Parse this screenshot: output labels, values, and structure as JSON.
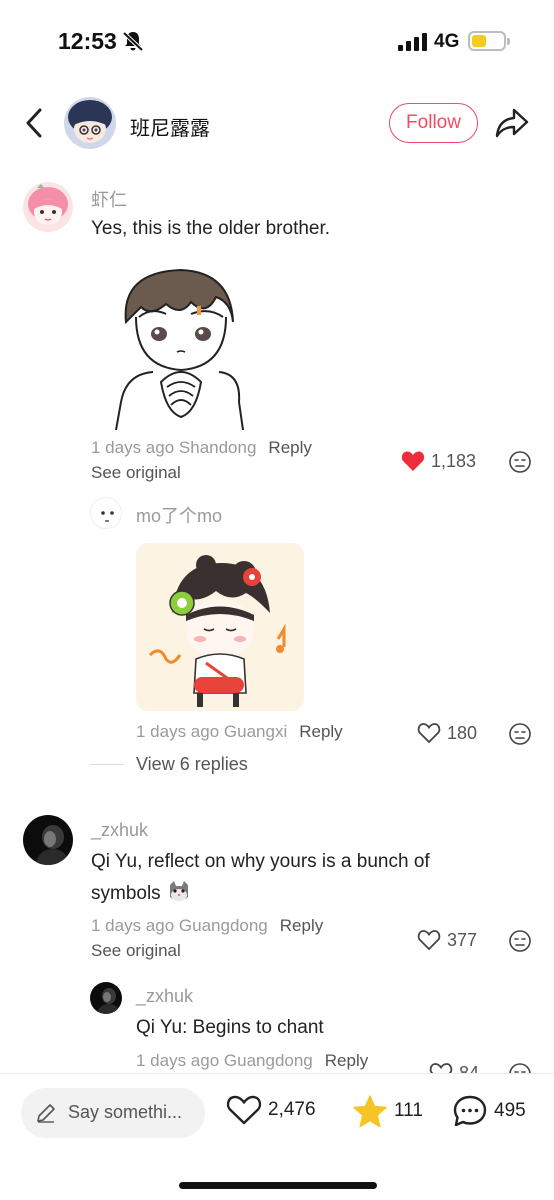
{
  "status_bar": {
    "time": "12:53",
    "network": "4G"
  },
  "header": {
    "author_name": "班尼露露",
    "follow_label": "Follow"
  },
  "comments": [
    {
      "username": "虾仁",
      "text": "Yes, this is the older brother.",
      "meta": "1 days ago Shandong",
      "reply_label": "Reply",
      "see_original": "See original",
      "likes": "1,183",
      "liked": true,
      "replies": [
        {
          "username": "mo了个mo",
          "meta": "1 days ago Guangxi",
          "reply_label": "Reply",
          "likes": "180"
        }
      ],
      "view_replies": "View 6 replies"
    },
    {
      "username": "_zxhuk",
      "text_line1": "Qi Yu, reflect on why yours is a bunch of",
      "text_line2": "symbols",
      "meta": "1 days ago Guangdong",
      "reply_label": "Reply",
      "see_original": "See original",
      "likes": "377",
      "replies": [
        {
          "username": "_zxhuk",
          "text": "Qi Yu: Begins to chant",
          "meta": "1 days ago Guangdong",
          "reply_label": "Reply",
          "likes": "84"
        }
      ]
    }
  ],
  "bottom_bar": {
    "say_placeholder": "Say somethi...",
    "likes": "2,476",
    "stars": "111",
    "comments": "495"
  },
  "colors": {
    "accent": "#f24b63",
    "like_red": "#ee2c3c",
    "star": "#f7c325"
  },
  "icons": [
    "bell-muted-icon",
    "signal-icon",
    "battery-icon",
    "back-chevron-icon",
    "share-icon",
    "heart-icon",
    "heart-filled-icon",
    "emoji-icon",
    "pen-icon",
    "star-icon",
    "comment-bubble-icon"
  ]
}
